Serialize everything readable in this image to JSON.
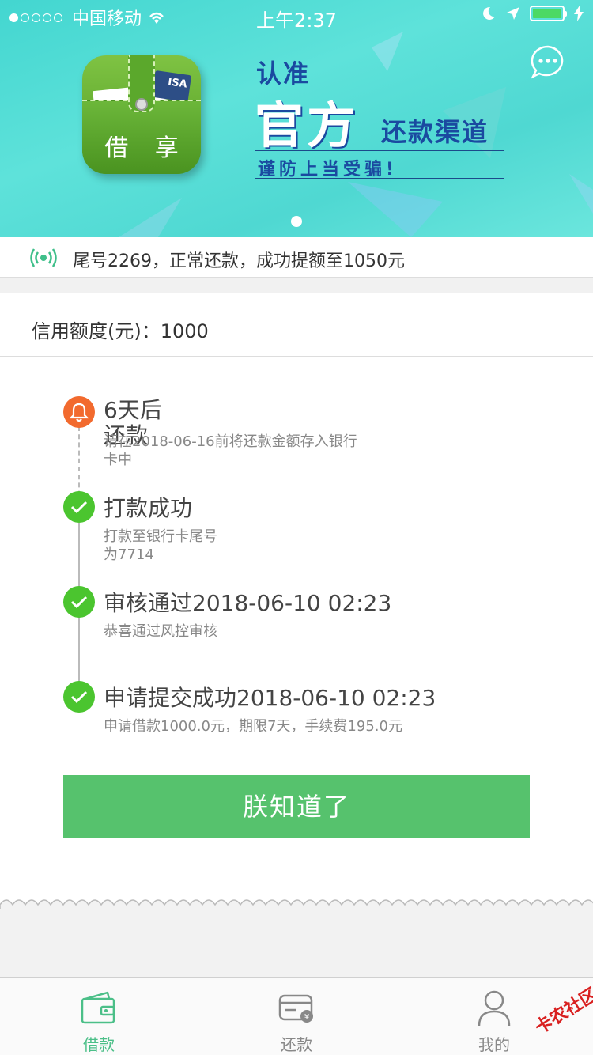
{
  "status_bar": {
    "carrier": "中国移动",
    "time": "上午2:37"
  },
  "banner": {
    "app_name": "借 享",
    "card_text": "ISA",
    "slogan_line1": "认准",
    "slogan_line2": "官方",
    "slogan_line3": "还款渠道",
    "slogan_line4": "谨防上当受骗!"
  },
  "notice": {
    "text": "尾号2269，正常还款，成功提额至1050元"
  },
  "credit": {
    "text": "信用额度(元)：1000"
  },
  "timeline": [
    {
      "title": "6天后还款",
      "desc": "请在2018-06-16前将还款金额存入银行卡中",
      "status": "pending",
      "color": "#f26a2e"
    },
    {
      "title": "打款成功",
      "desc_line1": "打款至银行卡尾号",
      "desc_line2": "为7714",
      "status": "done",
      "color": "#4bc52f"
    },
    {
      "title": "审核通过2018-06-10 02:23",
      "desc": "恭喜通过风控审核",
      "status": "done",
      "color": "#4bc52f"
    },
    {
      "title": "申请提交成功2018-06-10 02:23",
      "desc": "申请借款1000.0元，期限7天，手续费195.0元",
      "status": "done",
      "color": "#4bc52f"
    }
  ],
  "ok_button": {
    "label": "朕知道了"
  },
  "tabs": [
    {
      "label": "借款",
      "icon": "wallet-icon",
      "active": true
    },
    {
      "label": "还款",
      "icon": "repay-card-icon",
      "active": false
    },
    {
      "label": "我的",
      "icon": "user-icon",
      "active": false
    }
  ],
  "watermark": "卡农社区",
  "colors": {
    "accent_green": "#56c26d",
    "tab_active": "#4bbf88",
    "banner_teal": "#4fd8d2",
    "pending_orange": "#f26a2e"
  }
}
